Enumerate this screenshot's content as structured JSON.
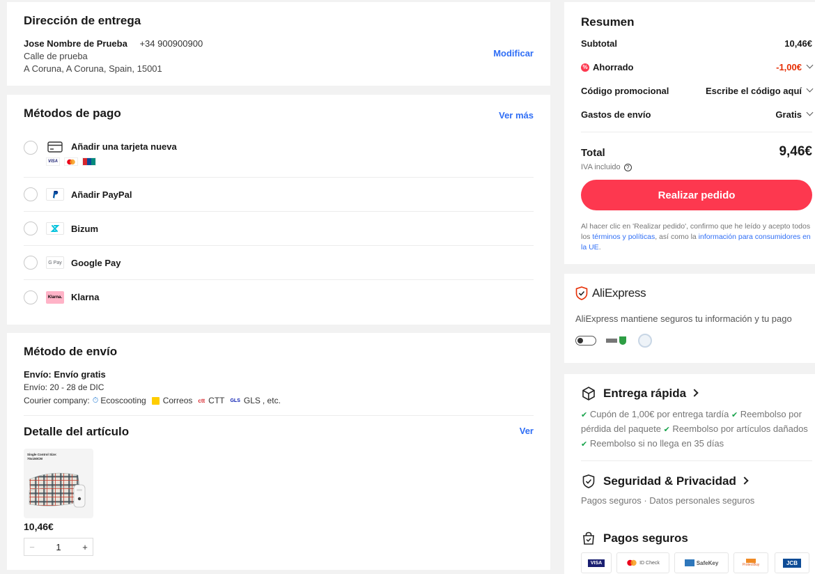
{
  "address": {
    "title": "Dirección de entrega",
    "name": "Jose Nombre de Prueba",
    "phone": "+34 900900900",
    "street": "Calle de prueba",
    "city": "A Coruna, A Coruna, Spain, 15001",
    "modify": "Modificar"
  },
  "payment": {
    "title": "Métodos de pago",
    "see_more": "Ver más",
    "methods": [
      {
        "label": "Añadir una tarjeta nueva",
        "icon": "credit-card-icon"
      },
      {
        "label": "Añadir PayPal",
        "icon": "paypal-icon"
      },
      {
        "label": "Bizum",
        "icon": "bizum-icon"
      },
      {
        "label": "Google Pay",
        "icon": "google-pay-icon"
      },
      {
        "label": "Klarna",
        "icon": "klarna-icon"
      }
    ],
    "card_brands": [
      "VISA",
      "Mastercard",
      "UnionPay"
    ],
    "gpay_text": "G Pay",
    "klarna_text": "Klarna."
  },
  "shipping": {
    "title": "Método de envío",
    "type": "Envío: Envío gratis",
    "dates": "Envío: 20 - 28 de DIC",
    "courier_prefix": "Courier company:",
    "couriers": [
      "Ecoscooting",
      "Correos",
      "CTT",
      "GLS"
    ],
    "courier_suffix": ", etc."
  },
  "item_detail": {
    "title": "Detalle del artículo",
    "view": "Ver",
    "image_caption": "Single Control Size: 70x150CM",
    "price": "10,46€",
    "quantity": "1",
    "minus": "−",
    "plus": "+"
  },
  "summary": {
    "title": "Resumen",
    "subtotal_label": "Subtotal",
    "subtotal_value": "10,46€",
    "saved_label": "Ahorrado",
    "saved_value": "-1,00€",
    "promo_label": "Código promocional",
    "promo_value": "Escribe el código aquí",
    "shipping_label": "Gastos de envío",
    "shipping_value": "Gratis",
    "total_label": "Total",
    "total_value": "9,46€",
    "vat": "IVA incluido",
    "order_button": "Realizar pedido",
    "legal_1": "Al hacer clic en 'Realizar pedido', confirmo que he leído y acepto todos los ",
    "legal_link_1": "términos y políticas",
    "legal_2": ", así como la ",
    "legal_link_2": "información para consumidores en la UE",
    "legal_3": "."
  },
  "trust": {
    "brand": "AliExpress",
    "text": "AliExpress mantiene seguros tu información y tu pago"
  },
  "benefits": {
    "fast_title": "Entrega rápida",
    "fast_items": [
      "Cupón de 1,00€ por entrega tardía",
      "Reembolso por pérdida del paquete",
      "Reembolso por artículos dañados",
      "Reembolso si no llega en 35 días"
    ],
    "security_title": "Seguridad & Privacidad",
    "security_text": "Pagos seguros · Datos personales seguros",
    "payments_title": "Pagos seguros",
    "pay_logos": [
      "VISA",
      "ID Check",
      "SafeKey",
      "ProtectBuy",
      "JCB"
    ]
  },
  "colors": {
    "accent": "#fd384f",
    "link": "#2f6ef5",
    "saved": "#e62e04",
    "check": "#16a34a"
  }
}
